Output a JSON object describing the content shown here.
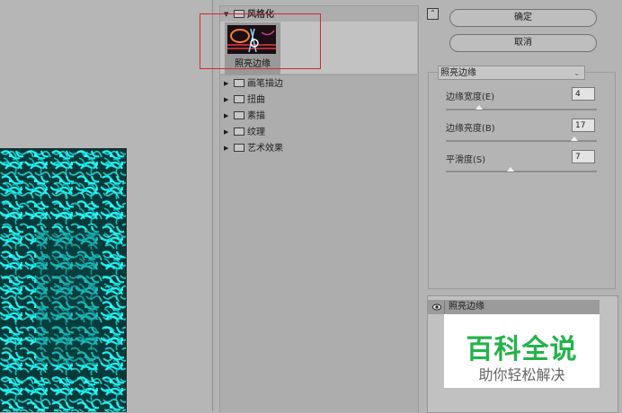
{
  "gallery": {
    "expanded_category": "风格化",
    "selected_filter_thumb": "照亮边缘",
    "categories": [
      "画笔描边",
      "扭曲",
      "素描",
      "纹理",
      "艺术效果"
    ]
  },
  "buttons": {
    "ok": "确定",
    "cancel": "取消"
  },
  "settings": {
    "filter_name": "照亮边缘",
    "params": [
      {
        "label": "边缘宽度(E)",
        "value": "4",
        "level": 0.22
      },
      {
        "label": "边缘亮度(B)",
        "value": "17",
        "level": 0.85
      },
      {
        "label": "平滑度(S)",
        "value": "7",
        "level": 0.43
      }
    ]
  },
  "layers": {
    "item": "照亮边缘"
  },
  "watermark": {
    "title": "百科全说",
    "subtitle": "助你轻松解决"
  },
  "colors": {
    "accent_select": "#d22a2a",
    "preview_glow": "#1ef0f0",
    "watermark_green": "#24b34a"
  }
}
